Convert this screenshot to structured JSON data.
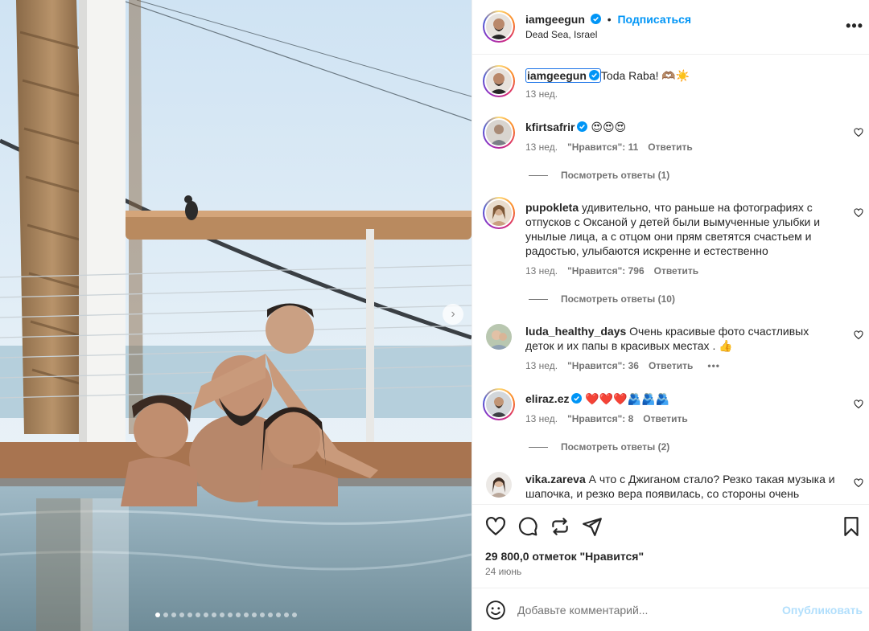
{
  "post": {
    "username": "iamgeegun",
    "follow_label": "Подписаться",
    "location": "Dead Sea, Israel",
    "more_label": "•••",
    "photo_dots": 18,
    "photo_active_dot": 0
  },
  "caption": {
    "username": "iamgeegun",
    "text": "Toda Raba! 🫶🏽☀️",
    "time": "13 нед."
  },
  "comments": [
    {
      "username": "kfirtsafrir",
      "verified": true,
      "text": "😍😍😍",
      "time": "13 нед.",
      "likes": "\"Нравится\": 11",
      "reply": "Ответить",
      "replies": "Посмотреть ответы (1)"
    },
    {
      "username": "pupokleta",
      "verified": false,
      "text": "удивительно, что раньше на фотографиях с отпусков с Оксаной у детей были вымученные улыбки и унылые лица, а с отцом они прям светятся счастьем и радостью, улыбаются искренне и естественно",
      "time": "13 нед.",
      "likes": "\"Нравится\": 796",
      "reply": "Ответить",
      "replies": "Посмотреть ответы (10)"
    },
    {
      "username": "luda_healthy_days",
      "verified": false,
      "text": "Очень красивые фото счастливых деток и их папы в красивых местах . 👍",
      "time": "13 нед.",
      "likes": "\"Нравится\": 36",
      "reply": "Ответить",
      "options": "•••"
    },
    {
      "username": "eliraz.ez",
      "verified": true,
      "text": "❤️❤️❤️🫂🫂🫂",
      "time": "13 нед.",
      "likes": "\"Нравится\": 8",
      "reply": "Ответить",
      "replies": "Посмотреть ответы (2)"
    },
    {
      "username": "vika.zareva",
      "verified": false,
      "text": "А что с Джиганом стало? Резко такая музыка и шапочка, и резко вера появилась, со стороны очень"
    }
  ],
  "actions": {
    "likes_text": "29 800,0 отметок \"Нравится\"",
    "date": "24 июнь"
  },
  "add_comment": {
    "placeholder": "Добавьте комментарий...",
    "publish_label": "Опубликовать"
  },
  "colors": {
    "accent": "#0095f6",
    "publish_disabled": "#b2dffc",
    "verified": "#0095f6",
    "muted": "#737373"
  }
}
